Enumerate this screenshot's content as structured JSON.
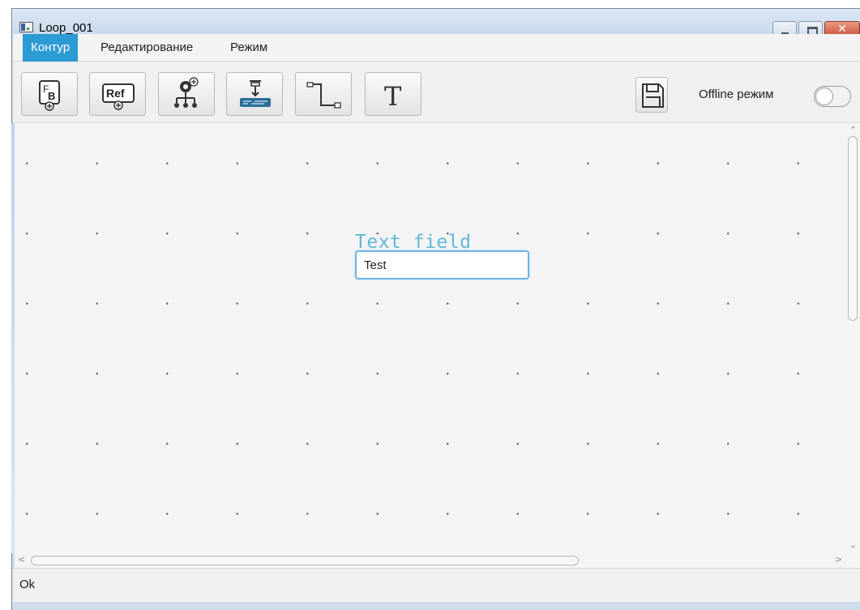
{
  "window": {
    "title": "Loop_001",
    "buttons": {
      "minimize": "minimize-icon",
      "maximize": "maximize-icon",
      "close": "close-icon"
    }
  },
  "menu": {
    "items": [
      {
        "label": "Контур",
        "active": true
      },
      {
        "label": "Редактирование",
        "active": false
      },
      {
        "label": "Режим",
        "active": false
      }
    ]
  },
  "toolbar": {
    "tools": [
      {
        "icon": "function-block-add-icon"
      },
      {
        "icon": "reference-add-icon"
      },
      {
        "icon": "network-add-icon"
      },
      {
        "icon": "device-input-icon"
      },
      {
        "icon": "connector-line-icon"
      },
      {
        "icon": "text-tool-icon"
      }
    ],
    "save_icon": "save-icon",
    "offline_label": "Offline режим",
    "offline_enabled": false
  },
  "canvas": {
    "text_field_label": "Text field",
    "text_field_value": "Test"
  },
  "status": {
    "text": "Ok"
  },
  "colors": {
    "accent": "#2d9bd3",
    "field_label": "#5fb9d6",
    "field_border": "#6ab5e6"
  }
}
